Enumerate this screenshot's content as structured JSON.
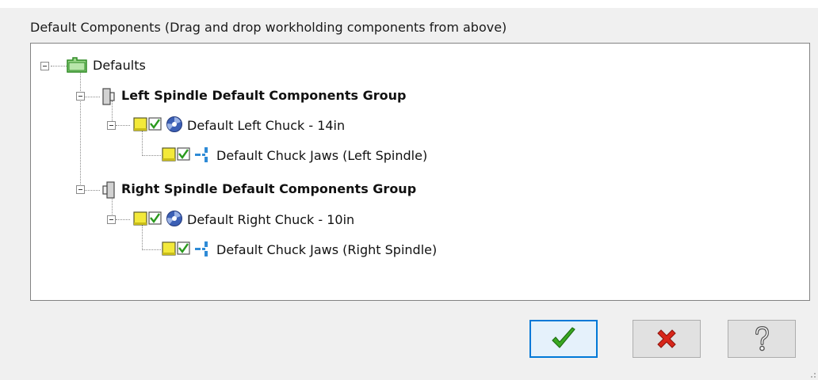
{
  "panel": {
    "label": "Default Components (Drag and drop workholding components from above)"
  },
  "tree": {
    "root": "Defaults",
    "left_group": "Left Spindle Default Components Group",
    "left_chuck": "Default Left Chuck - 14in",
    "left_jaws": "Default Chuck Jaws (Left Spindle)",
    "right_group": "Right Spindle Default Components Group",
    "right_chuck": "Default Right Chuck - 10in",
    "right_jaws": "Default Chuck Jaws (Right Spindle)"
  },
  "icons": {
    "root": "folder-icon",
    "group": "spindle-icon",
    "chuck": "chuck-icon",
    "jaws": "chuck-jaws-icon",
    "state": "yellow-box-icon",
    "checked": "checkbox-checked-icon",
    "ok": "green-checkmark-icon",
    "cancel": "red-x-icon",
    "help": "question-mark-icon"
  },
  "colors": {
    "accent": "#0078d7",
    "ok_green": "#3aa821",
    "cancel_red": "#d8261a",
    "state_yellow": "#f3e93a"
  }
}
